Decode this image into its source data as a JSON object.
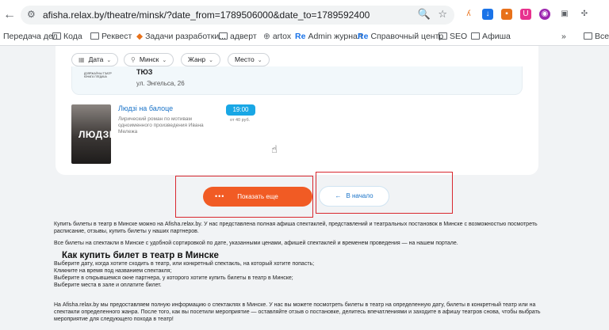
{
  "browser": {
    "url": "afisha.relax.by/theatre/minsk/?date_from=1789506000&date_to=1789592400",
    "bookmarks": [
      "Передача дел",
      "Кода",
      "Реквест",
      "Задачи разработки...",
      "адверт",
      "artox",
      "Admin журнал",
      "Справочный центр",
      "SEO",
      "Афиша",
      "Все"
    ],
    "more_bookmarks": "»"
  },
  "filters": {
    "date": "Дата",
    "city": "Минск",
    "genre": "Жанр",
    "place": "Место"
  },
  "venue": {
    "logo_text": "ДЗЯРЖАЎНЫ ТЭАТР ЮНАГА ГЛЕДАЧА",
    "name": "ТЮЗ",
    "address": "ул. Энгельса, 26"
  },
  "show": {
    "poster_text": "ЛЮДЗІ",
    "title": "Людзі на балоце",
    "description": "Лирический роман по мотивам одноименного произведения Ивана Мележа",
    "time": "19:00",
    "price": "от 40 руб."
  },
  "buttons": {
    "more": "Показать еще",
    "more_dots": "•••",
    "start": "В начало"
  },
  "seo": {
    "intro": "Купить билеты в театр в Минске можно на Afisha.relax.by. У нас представлена полная афиша спектаклей, представлений и театральных постановок в Минске с возможностью посмотреть расписание, отзывы, купить билеты у наших партнеров.",
    "all_tickets": "Все билеты на спектакли в Минске с удобной сортировкой по дате, указанными ценами, афишей спектаклей и временем проведения — на нашем портале.",
    "heading": "Как купить билет в театр в Минске",
    "steps": [
      "Выберите дату, когда хотите сходить в театр, или конкретный спектакль, на который хотите попасть;",
      "Кликните на время под названием спектакля;",
      "Выберите в открывшемся окне партнера, у которого хотите купить билеты в театр в Минске;",
      "Выберите места в зале и оплатите билет."
    ],
    "info": "На Afisha.relax.by мы предоставляем полную информацию о спектаклях в Минске. У нас вы можете посмотреть билеты в театр на определенную дату, билеты в конкретный театр или на спектакли определенного жанра. После того, как вы посетили мероприятие — оставляйте отзыв о постановке, делитесь впечатлениями и заходите в афишу театров снова, чтобы выбрать мероприятие для следующего похода в театр!"
  }
}
